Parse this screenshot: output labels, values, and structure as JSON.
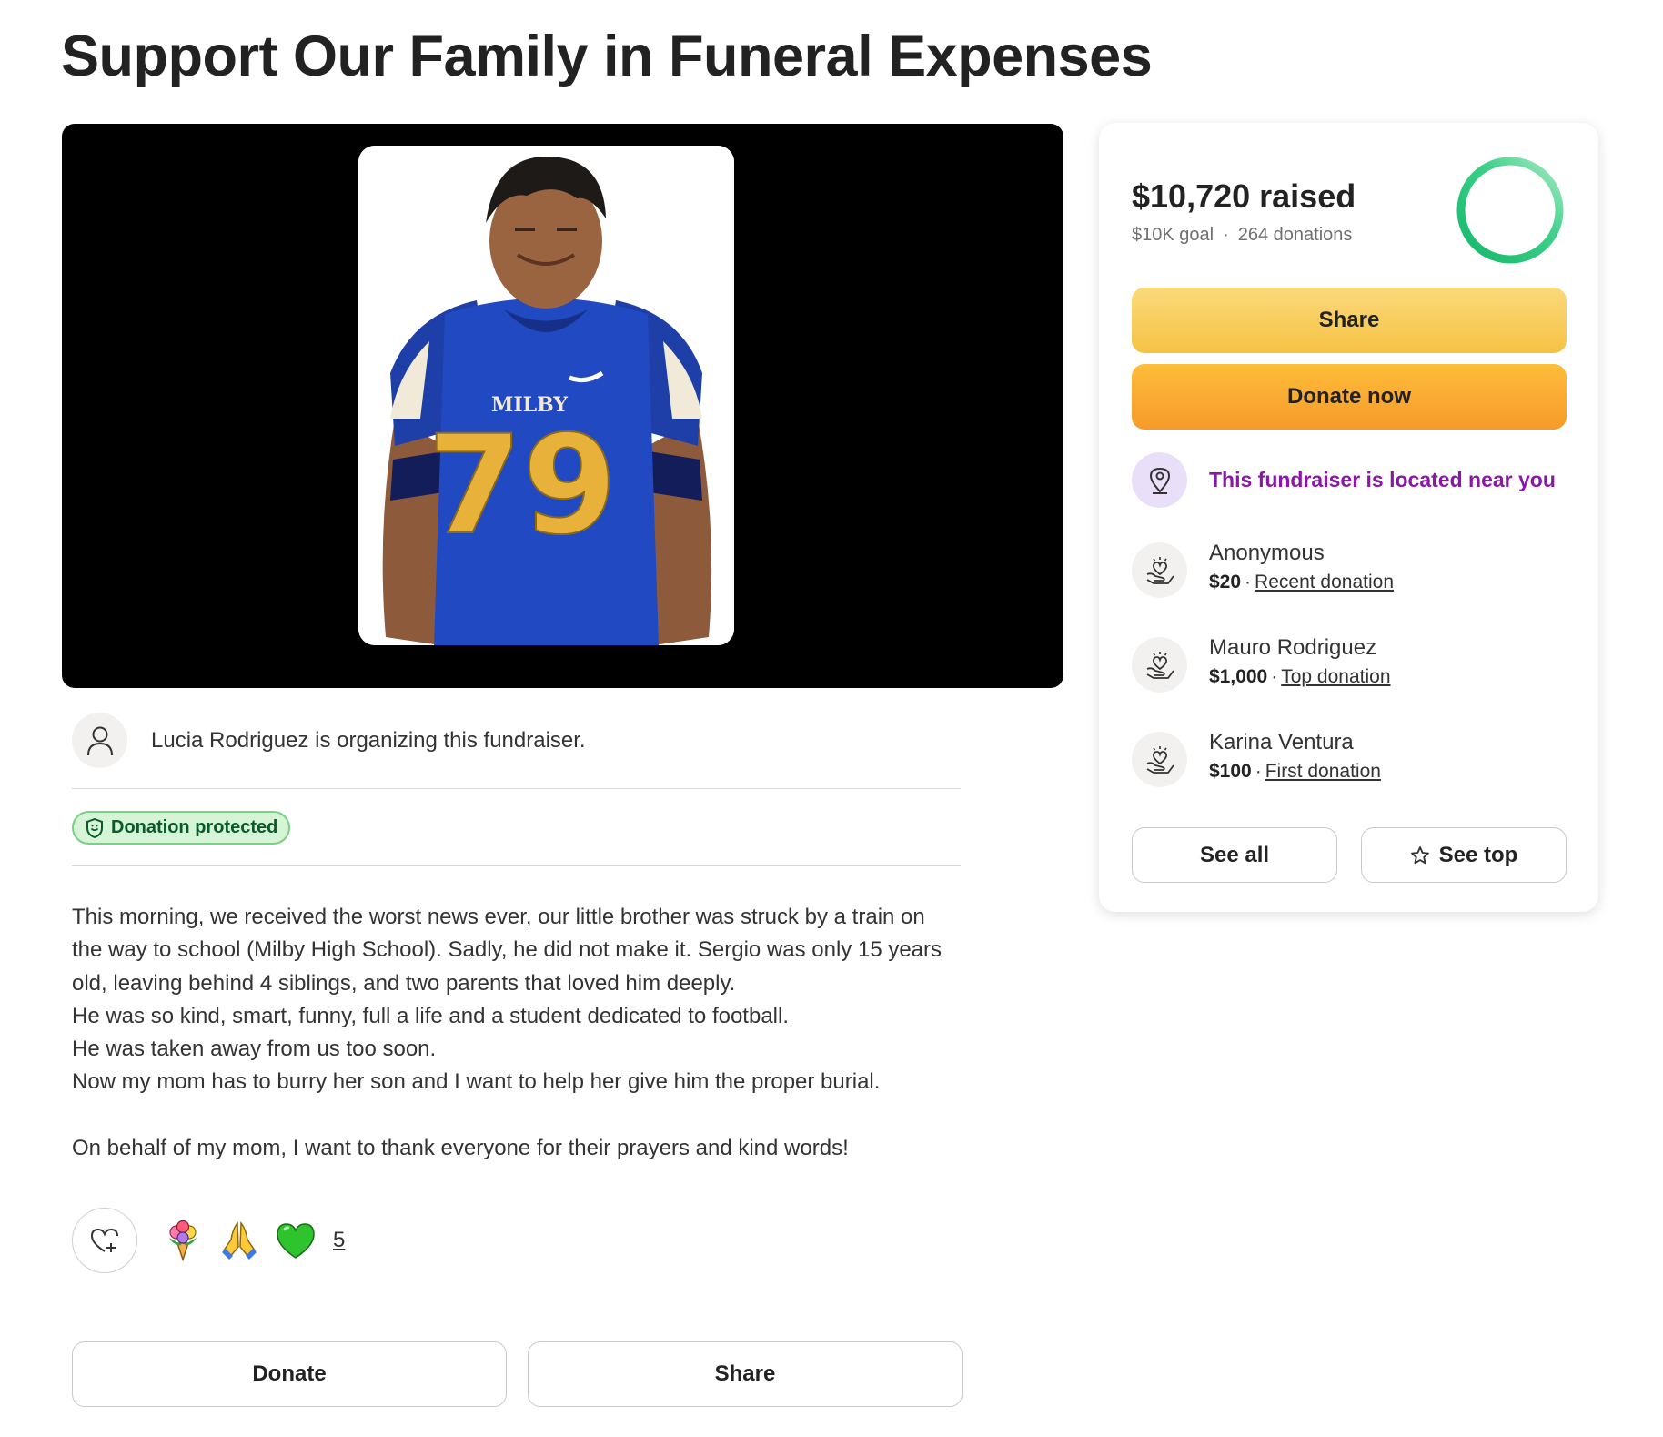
{
  "page": {
    "title": "Support Our Family in Funeral Expenses"
  },
  "organizer": {
    "text": "Lucia Rodriguez is organizing this fundraiser."
  },
  "badge": {
    "label": "Donation protected"
  },
  "story": {
    "lines": [
      "This morning, we received the worst news ever, our little brother was struck by a train on",
      "the way to school (Milby High School). Sadly, he did not make it. Sergio was only 15 years",
      "old, leaving  behind 4 siblings, and two parents that loved him deeply.",
      "He was so kind, smart, funny, full a life and a student dedicated to football.",
      "He was taken away from us too soon.",
      "Now my mom has to burry her son and I want to help her give him the proper burial.",
      "",
      "On behalf of my mom, I want to thank everyone for their prayers and kind words!"
    ]
  },
  "reactions": {
    "emojis": [
      "bouquet-icon",
      "folded-hands-icon",
      "green-heart-icon"
    ],
    "count": "5"
  },
  "bottom_actions": {
    "donate_label": "Donate",
    "share_label": "Share"
  },
  "photo": {
    "jersey_text": "MILBY",
    "jersey_number": "79"
  },
  "card": {
    "raised": "$10,720 raised",
    "goal": "$10K goal",
    "separator": "·",
    "donations": "264 donations",
    "progress_fraction": 1.0,
    "share_label": "Share",
    "donate_label": "Donate now",
    "location_text": "This fundraiser is located near you",
    "donors": [
      {
        "name": "Anonymous",
        "amount": "$20",
        "sep": "·",
        "tag": "Recent donation"
      },
      {
        "name": "Mauro Rodriguez",
        "amount": "$1,000",
        "sep": "·",
        "tag": "Top donation"
      },
      {
        "name": "Karina Ventura",
        "amount": "$100",
        "sep": "·",
        "tag": "First donation"
      }
    ],
    "see_all_label": "See all",
    "see_top_label": "See top"
  },
  "colors": {
    "share_yellow": "#f6c244",
    "donate_orange": "#f79a2a",
    "progress_green": "#12b76a",
    "location_purple": "#8a17a8",
    "badge_green": "#0b5b2a"
  }
}
